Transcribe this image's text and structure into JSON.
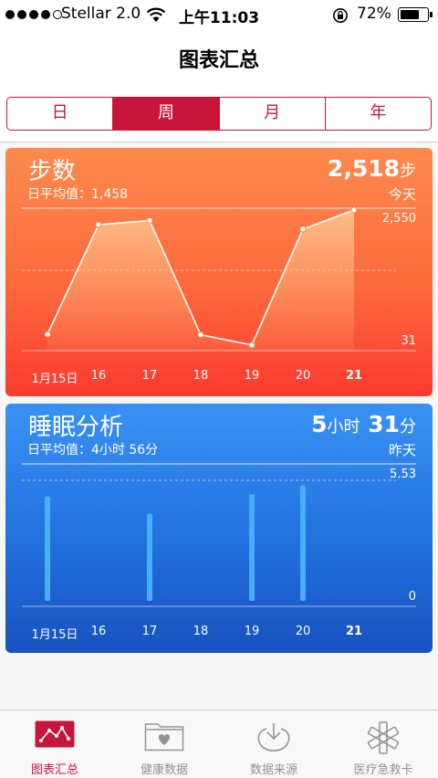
{
  "status_bar": {
    "carrier": "Stellar 2.0",
    "time": "上午11:03",
    "battery_percent": "72%",
    "battery_level": 0.72
  },
  "nav": {
    "title": "图表汇总"
  },
  "segments": [
    {
      "label": "日",
      "active": false
    },
    {
      "label": "周",
      "active": true
    },
    {
      "label": "月",
      "active": false
    },
    {
      "label": "年",
      "active": false
    }
  ],
  "steps_card": {
    "title": "步数",
    "subtitle": "日平均值：1,458",
    "value": "2,518",
    "unit": "步",
    "when": "今天",
    "color": "#fd6a3c",
    "chart_data": {
      "type": "area",
      "categories": [
        "1月15日",
        "16",
        "17",
        "18",
        "19",
        "20",
        "21"
      ],
      "values": [
        320,
        2260,
        2330,
        310,
        130,
        2180,
        2518
      ],
      "ylim": [
        31,
        2550
      ],
      "max_label": "2,550",
      "min_label": "31"
    }
  },
  "sleep_card": {
    "title": "睡眠分析",
    "subtitle": "日平均值：4小时 56分",
    "value_hours": "5",
    "unit_hours": "小时",
    "value_minutes": "31",
    "unit_minutes": "分",
    "when": "昨天",
    "color": "#2170de",
    "chart_data": {
      "type": "bar",
      "categories": [
        "1月15日",
        "16",
        "17",
        "18",
        "19",
        "20",
        "21"
      ],
      "values": [
        4.8,
        0,
        4.0,
        0,
        4.9,
        5.3,
        0
      ],
      "ylim": [
        0,
        5.53
      ],
      "max_label": "5.53",
      "min_label": "0"
    }
  },
  "tabbar": {
    "tabs": [
      {
        "label": "图表汇总",
        "icon": "chart-icon",
        "active": true
      },
      {
        "label": "健康数据",
        "icon": "health-data-folder-icon",
        "active": false
      },
      {
        "label": "数据来源",
        "icon": "sources-download-icon",
        "active": false
      },
      {
        "label": "医疗急救卡",
        "icon": "medical-id-icon",
        "active": false
      }
    ],
    "active_color": "#c8163a"
  }
}
